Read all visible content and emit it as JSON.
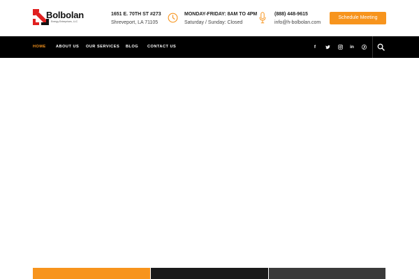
{
  "brand": {
    "name": "Bolbolan",
    "tagline": "Energy Enterprises, LLC",
    "accent_color": "#f7941d",
    "logo_red": "#e02020"
  },
  "header": {
    "address": {
      "line1": "1651 E. 70TH ST #273",
      "line2": "Shreveport, LA 71105"
    },
    "hours": {
      "line1": "MONDAY-FRIDAY: 8AM TO 4PM",
      "line2": "Saturday / Sunday: Closed",
      "icon": "clock-icon"
    },
    "contact": {
      "phone": "(888) 448-9615",
      "email": "info@h-bolbolan.com",
      "icon": "microphone-icon"
    },
    "cta_label": "Schedule Meeting"
  },
  "nav": {
    "items": [
      {
        "label": "HOME",
        "active": true
      },
      {
        "label": "ABOUT US",
        "active": false
      },
      {
        "label": "OUR SERVICES",
        "active": false
      },
      {
        "label": "BLOG",
        "active": false
      },
      {
        "label": "CONTACT US",
        "active": false
      }
    ],
    "social": [
      {
        "name": "facebook-icon",
        "glyph": "f"
      },
      {
        "name": "twitter-icon",
        "glyph": "🐦"
      },
      {
        "name": "instagram-icon",
        "glyph": "◎"
      },
      {
        "name": "linkedin-icon",
        "glyph": "in"
      },
      {
        "name": "pinterest-icon",
        "glyph": "P"
      }
    ],
    "search_icon": "search-icon",
    "background": "#000000"
  },
  "features": {
    "colors": [
      "#f7941d",
      "#1a1a1a",
      "#3a3a3a"
    ]
  }
}
